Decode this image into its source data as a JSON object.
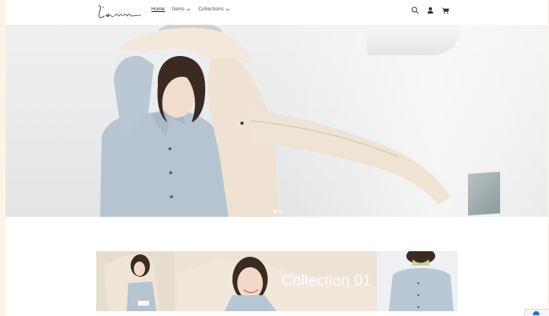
{
  "header": {
    "logo_alt": "l'enim",
    "nav": [
      {
        "label": "Home",
        "active": true,
        "has_dropdown": false
      },
      {
        "label": "Items",
        "active": false,
        "has_dropdown": true
      },
      {
        "label": "Collections",
        "active": false,
        "has_dropdown": true
      }
    ],
    "icons": [
      "search-icon",
      "account-icon",
      "cart-icon"
    ]
  },
  "hero": {
    "slides_count": 2,
    "active_slide": 1
  },
  "collection": {
    "title": "Collection 01"
  },
  "colors": {
    "page_bg": "#fdf8ee",
    "header_bg": "#ffffff",
    "text": "#4a4a4a"
  }
}
